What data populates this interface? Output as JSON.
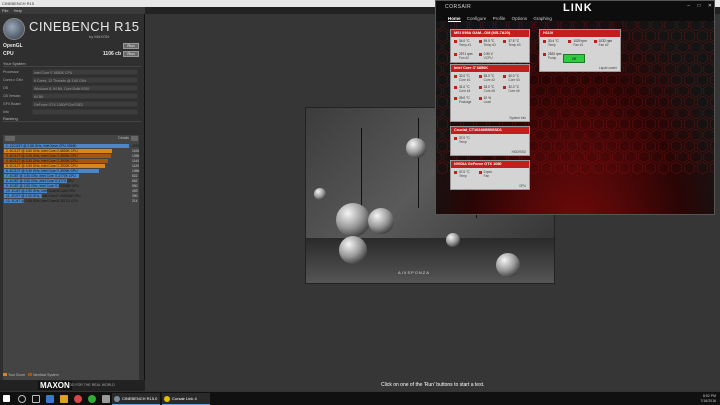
{
  "cinebench": {
    "window_title": "CINEBENCH R15",
    "menu": [
      "File",
      "Help"
    ],
    "logo_title": "CINEBENCH R15",
    "logo_by": "by MAXON",
    "opengl_label": "OpenGL",
    "opengl_run": "Run",
    "cpu_label": "CPU",
    "cpu_value": "1106 cb",
    "cpu_run": "Run",
    "system_title": "Your System",
    "system": [
      {
        "key": "Processor",
        "value": "Intel Core i7 6850K CPU"
      },
      {
        "key": "Cores x GHz",
        "value": "6 Cores, 12 Threads @ 3.60 GHz"
      },
      {
        "key": "OS",
        "value": "Windows 8, 64 Bit, Core Build 9200"
      },
      {
        "key": "CB Version",
        "value": "64 Bit"
      },
      {
        "key": "GFX Board",
        "value": "GeForce GTX 1080/PCIe/SSE2"
      },
      {
        "key": "Info",
        "value": ""
      }
    ],
    "ranking_title": "Ranking",
    "ranking_select": "CPU",
    "ranking_details": "Details",
    "ranking": [
      {
        "label": "1. 12C/24T @ 2.66 GHz, Intel Xeon CPU X5650",
        "score": "1279",
        "color": "#4a86c8",
        "frac": 1.0
      },
      {
        "label": "2. 6C/12T @ 3.60 GHz, Intel Core i7-6850K CPU",
        "score": "1106",
        "color": "#d9871c",
        "frac": 0.865
      },
      {
        "label": "3. 6C/12T @ 3.30 GHz, Intel Core i7-3930K CPU",
        "score": "1096",
        "color": "#a3560f",
        "frac": 0.857
      },
      {
        "label": "4. 6C/12T @ 3.30 GHz, Intel Core i7-3930K CPU",
        "score": "1144",
        "color": "#a3560f",
        "frac": 0.83
      },
      {
        "label": "5. 6C/12T @ 3.50 GHz, Intel Core i7-3930K CPU",
        "score": "1120",
        "color": "#d9871c",
        "frac": 0.81
      },
      {
        "label": "6. 6C/12T @ 3.30 GHz, Intel Core i7-3930K CPU",
        "score": "1056",
        "color": "#4a86c8",
        "frac": 0.76
      },
      {
        "label": "7. 4C/8T @ 3.40 GHz, Intel Core i7-4770K CPU",
        "score": "822",
        "color": "#4a86c8",
        "frac": 0.6
      },
      {
        "label": "8. 4C/8T @ 3.50 GHz, Intel Core i7-3770 CPU",
        "score": "662",
        "color": "#4a86c8",
        "frac": 0.5
      },
      {
        "label": "9. 4C/8T @ 2.60 GHz, Intel Core i7-3720QM CPU",
        "score": "590",
        "color": "#4a86c8",
        "frac": 0.44
      },
      {
        "label": "10. 4C/4T @ 2.50 GHz, Intel Core i5-2400 CPU",
        "score": "453",
        "color": "#4a86c8",
        "frac": 0.34
      },
      {
        "label": "11. 4C/4T @ 2.00 GHz, Intel Core i7-2630QM CPU",
        "score": "390",
        "color": "#4a86c8",
        "frac": 0.3
      },
      {
        "label": "12. 2C/4T @ 1.60 GHz, Intel Core i5-3317U CPU",
        "score": "214",
        "color": "#4a86c8",
        "frac": 0.16
      }
    ],
    "legend_your_score": "Your Score",
    "legend_identical": "Identical System",
    "maxon_logo": "MAXON",
    "maxon_tag": "3D FOR THE REAL WORLD",
    "status_message": "Click on one of the 'Run' buttons to start a test.",
    "render_signature": "AIXSPONZA"
  },
  "link": {
    "brand": "CORSAIR",
    "title": "LINK",
    "nav": [
      "Home",
      "Configure",
      "Profile",
      "Options",
      "Graphing"
    ],
    "motherboard": {
      "title": "MSI X99A GAM...OM (MS-7A20)",
      "sensors": [
        {
          "v": "34.0 °C",
          "n": "Temp #1"
        },
        {
          "v": "59.5 °C",
          "n": "Temp #2"
        },
        {
          "v": "37.5 °C",
          "n": "Temp #3"
        },
        {
          "v": "2571 rpm",
          "n": "Fan #2"
        },
        {
          "v": "0.90 V",
          "n": "VCPU"
        }
      ]
    },
    "cpu": {
      "title": "Intel Core i7 6850K",
      "sensors": [
        {
          "v": "32.0 °C",
          "n": "Core #1"
        },
        {
          "v": "35.0 °C",
          "n": "Core #2"
        },
        {
          "v": "40.0 °C",
          "n": "Core #3"
        },
        {
          "v": "31.0 °C",
          "n": "Core #4"
        },
        {
          "v": "33.0 °C",
          "n": "Core #5"
        },
        {
          "v": "32.0 °C",
          "n": "Core #6"
        },
        {
          "v": "39.0 °C",
          "n": "Package"
        },
        {
          "v": "10 %",
          "n": "Load"
        }
      ],
      "footer": "System info"
    },
    "h100": {
      "title": "H110i",
      "sensors": [
        {
          "v": "30.4 °C",
          "n": "Temp"
        },
        {
          "v": "1029 rpm",
          "n": "Fan #1"
        },
        {
          "v": "1032 rpm",
          "n": "Fan #2"
        },
        {
          "v": "2520 rpm",
          "n": "Pump"
        }
      ],
      "pump_button": "Off",
      "footer": "Liquid cooler"
    },
    "ssd": {
      "title": "Crucial_CT1024M550SSD1",
      "sensors": [
        {
          "v": "37.0 °C",
          "n": "Temp"
        }
      ],
      "footer": "HDD/SSD"
    },
    "gpu": {
      "title": "NVIDIA GeForce GTX 1080",
      "sensors": [
        {
          "v": "37.0 °C",
          "n": "Temp"
        },
        {
          "v": "0 rpm",
          "n": "Fan"
        }
      ],
      "footer": "GPU"
    }
  },
  "taskbar": {
    "apps": [
      "CINEBENCH R15.0",
      "Corsair Link 4"
    ],
    "time": "8:52 PM",
    "date": "7/16/2016"
  }
}
